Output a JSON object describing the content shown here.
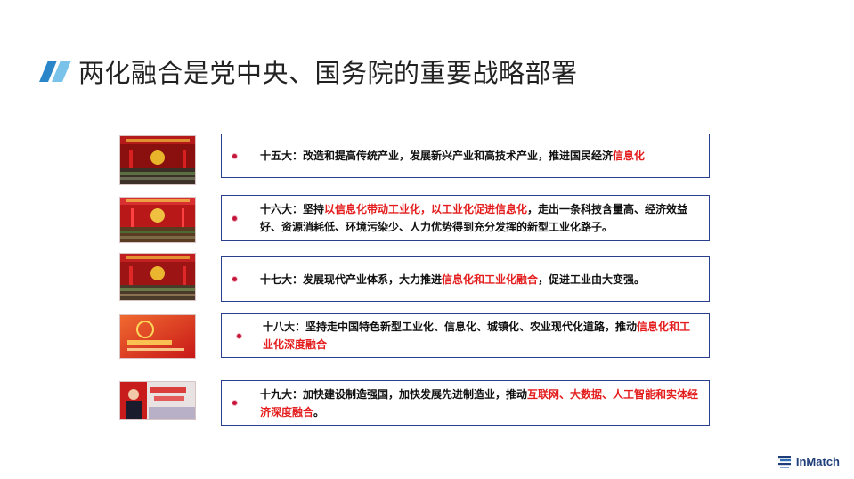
{
  "title": "两化融合是党中央、国务院的重要战略部署",
  "items": [
    {
      "segments": [
        {
          "text": "十五大：改造和提高传统产业，发展新兴产业和高技术产业，推进国民经济",
          "red": false
        },
        {
          "text": "信息化",
          "red": true
        }
      ]
    },
    {
      "segments": [
        {
          "text": "十六大：坚持",
          "red": false
        },
        {
          "text": "以信息化带动工业化，以工业化促进信息化",
          "red": true
        },
        {
          "text": "，走出一条科技含量高、经济效益好、资源消耗低、环境污染少、人力优势得到充分发挥的新型工业化路子。",
          "red": false
        }
      ]
    },
    {
      "segments": [
        {
          "text": "十七大：发展现代产业体系，大力推进",
          "red": false
        },
        {
          "text": "信息化和工业化融合",
          "red": true
        },
        {
          "text": "，促进工业由大变强。",
          "red": false
        }
      ]
    },
    {
      "segments": [
        {
          "text": "十八大：坚持走中国特色新型工业化、信息化、城镇化、农业现代化道路，推动",
          "red": false
        },
        {
          "text": "信息化和工业化深度融合",
          "red": true
        }
      ]
    },
    {
      "segments": [
        {
          "text": "十九大：加快建设制造强国，加快发展先进制造业，推动",
          "red": false
        },
        {
          "text": "互联网、大数据、人工智能和实体经济深度融合",
          "red": true
        },
        {
          "text": "。",
          "red": false
        }
      ]
    }
  ],
  "logo": {
    "text": "InMatch"
  },
  "colors": {
    "accent_red": "#e41e1e",
    "box_border": "#2b3f8f",
    "title_mark": "#3a9bd6"
  },
  "icons": [
    "title-slash-icon",
    "inmatch-logo-icon"
  ]
}
